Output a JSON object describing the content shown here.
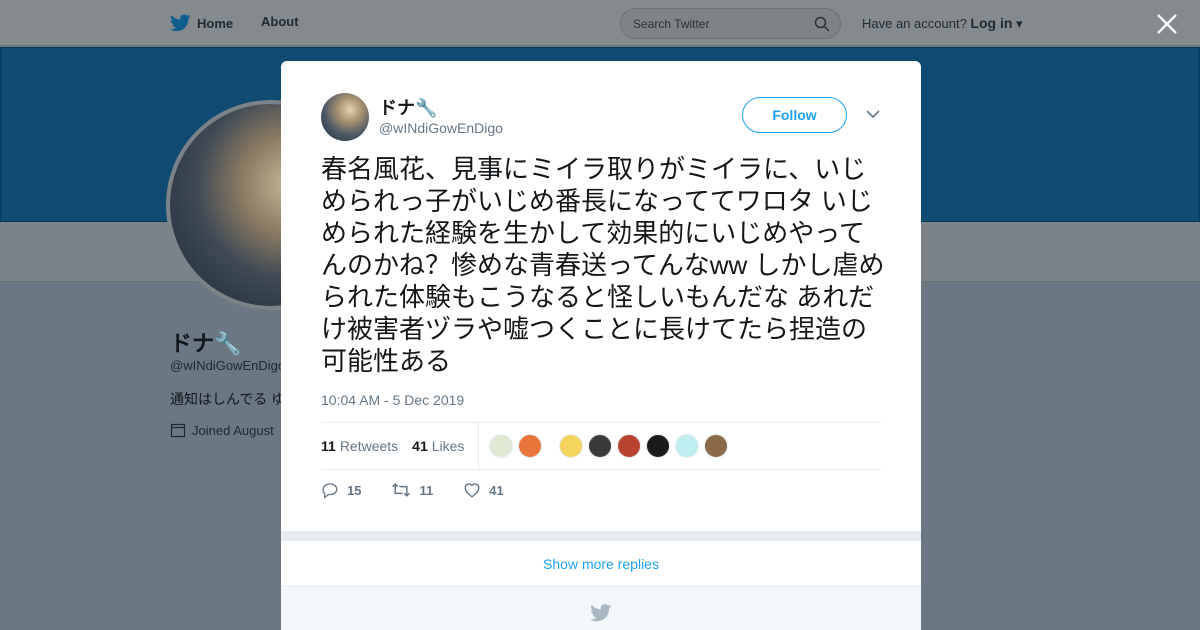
{
  "topbar": {
    "home_label": "Home",
    "about_label": "About",
    "search_placeholder": "Search Twitter",
    "account_prompt": "Have an account?",
    "login_label": "Log in"
  },
  "profile": {
    "name": "ドナ🔧",
    "handle": "@wINdiGowEnDigo",
    "bio": "通知はしんでる ゆ",
    "joined": "Joined August"
  },
  "tweet": {
    "author_name": "ドナ🔧",
    "author_handle": "@wINdiGowEnDigo",
    "follow_label": "Follow",
    "text": "春名風花、見事にミイラ取りがミイラに、いじめられっ子がいじめ番長になっててワロタ いじめられた経験を生かして効果的にいじめやってんのかね？惨めな青春送ってんなww しかし虐められた体験もこうなると怪しいもんだな あれだけ被害者ヅラや嘘つくことに長けてたら捏造の可能性ある",
    "timestamp": "10:04 AM - 5 Dec 2019",
    "retweets_count": "11",
    "retweets_label": "Retweets",
    "likes_count": "41",
    "likes_label": "Likes",
    "reply_count": "15",
    "retweet_action_count": "11",
    "like_action_count": "41",
    "likers": [
      {
        "color": "#dfe9d4"
      },
      {
        "color": "#e8763a"
      },
      {
        "color": "#f4d35e"
      },
      {
        "color": "#3a3a3a"
      },
      {
        "color": "#b8432f"
      },
      {
        "color": "#1b1b1b"
      },
      {
        "color": "#bfeef0"
      },
      {
        "color": "#8b6a4a"
      }
    ]
  },
  "replies": {
    "show_more_label": "Show more replies"
  },
  "colors": {
    "accent": "#1da1f2",
    "banner": "#0e4a72",
    "muted": "#657786"
  }
}
